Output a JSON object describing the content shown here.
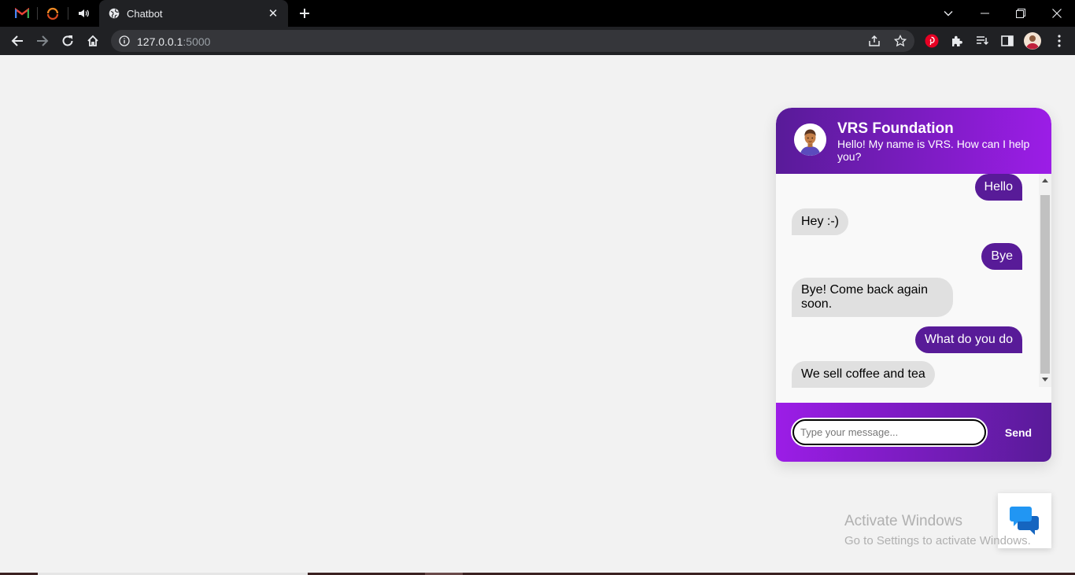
{
  "browser": {
    "tab_title": "Chatbot",
    "tab_close": "✕",
    "url_host": "127.0.0.1",
    "url_port": ":5000"
  },
  "chat": {
    "title": "VRS Foundation",
    "subtitle": "Hello! My name is VRS. How can I help you?",
    "messages": [
      {
        "from": "user",
        "text": "Hello"
      },
      {
        "from": "bot",
        "text": "Hey :-)"
      },
      {
        "from": "user",
        "text": "Bye"
      },
      {
        "from": "bot",
        "text": "Bye! Come back again soon."
      },
      {
        "from": "user",
        "text": "What do you do"
      },
      {
        "from": "bot",
        "text": "We sell coffee and tea"
      }
    ],
    "input_placeholder": "Type your message...",
    "send_label": "Send",
    "colors": {
      "primary": "#581b98",
      "accent": "#9c1de7",
      "bot_bubble": "#e0e0e0"
    }
  },
  "watermark": {
    "title": "Activate Windows",
    "subtitle": "Go to Settings to activate Windows."
  }
}
